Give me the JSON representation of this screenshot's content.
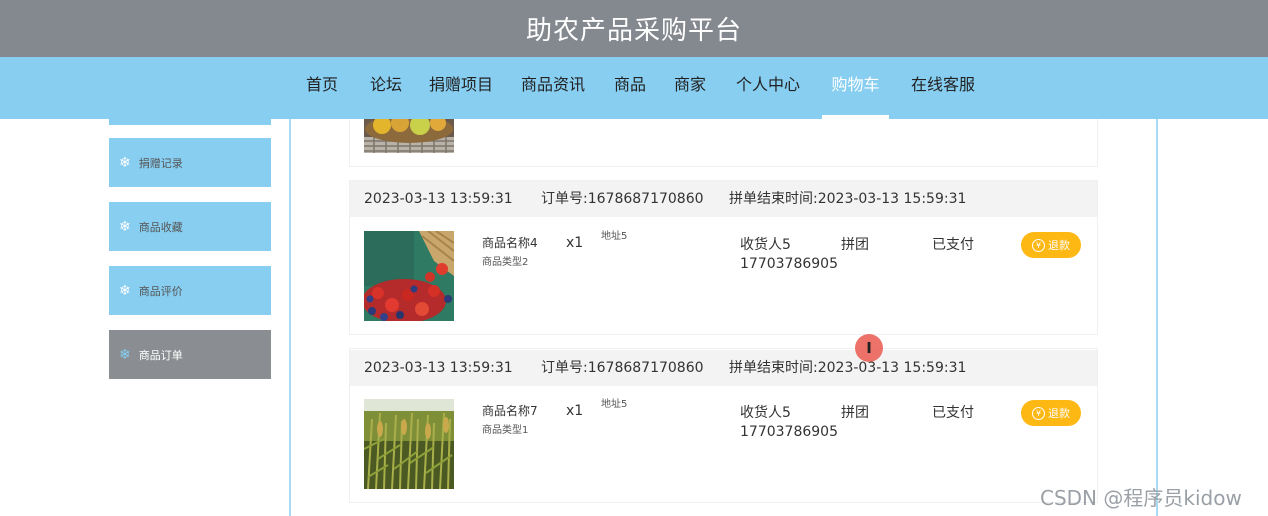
{
  "header": {
    "title": "助农产品采购平台"
  },
  "nav": {
    "items": [
      "首页",
      "论坛",
      "捐赠项目",
      "商品资讯",
      "商品",
      "商家",
      "个人中心",
      "购物车",
      "在线客服"
    ],
    "active_index": 7
  },
  "sidebar": {
    "icon": "snowflake-icon",
    "items": [
      "捐赠记录",
      "商品收藏",
      "商品评价",
      "商品订单"
    ],
    "active_index": 3
  },
  "orders": [
    {
      "date": "2023-03-13 13:59:31",
      "order_no": "订单号:1678687170860",
      "group_end": "拼单结束时间:2023-03-13 15:59:31",
      "product_name": "商品名称4",
      "product_type": "商品类型2",
      "qty": "x1",
      "address": "地址5",
      "receiver": "收货人5",
      "phone": "17703786905",
      "order_type": "拼团",
      "status": "已支付",
      "refund_label": "退款",
      "image": "strawberries-blueberries-basket"
    },
    {
      "date": "2023-03-13 13:59:31",
      "order_no": "订单号:1678687170860",
      "group_end": "拼单结束时间:2023-03-13 15:59:31",
      "product_name": "商品名称7",
      "product_type": "商品类型1",
      "qty": "x1",
      "address": "地址5",
      "receiver": "收货人5",
      "phone": "17703786905",
      "order_type": "拼团",
      "status": "已支付",
      "refund_label": "退款",
      "image": "corn-field"
    }
  ],
  "cursor": {
    "glyph": "I"
  },
  "watermark": "CSDN @程序员kidow",
  "colors": {
    "header_bg": "#84888f",
    "nav_bg": "#87cef1",
    "active_sidebar_bg": "#8a8e92",
    "refund_btn": "#fdb813"
  }
}
